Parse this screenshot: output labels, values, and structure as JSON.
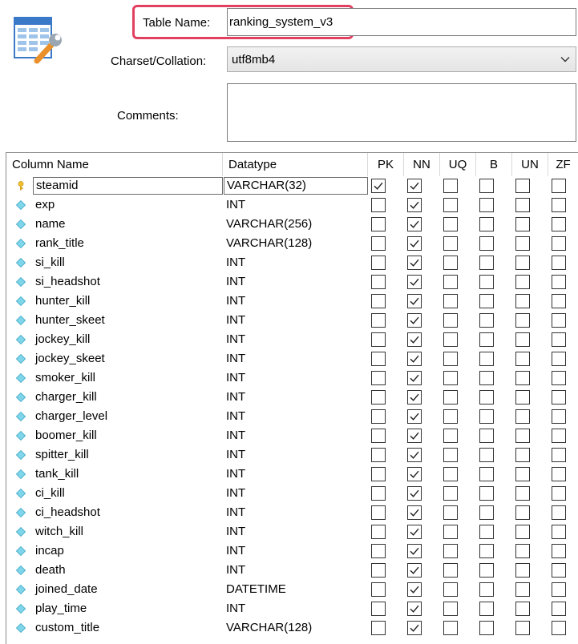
{
  "header": {
    "table_name_label": "Table Name:",
    "table_name_value": "ranking_system_v3",
    "charset_label": "Charset/Collation:",
    "charset_value": "utf8mb4",
    "comments_label": "Comments:",
    "comments_value": "",
    "highlight_color": "#e24060"
  },
  "grid": {
    "columns": [
      "Column Name",
      "Datatype",
      "PK",
      "NN",
      "UQ",
      "B",
      "UN",
      "ZF"
    ],
    "flag_keys": [
      "pk",
      "nn",
      "uq",
      "b",
      "un",
      "zf"
    ],
    "rows": [
      {
        "name": "steamid",
        "type": "VARCHAR(32)",
        "icon": "key-icon",
        "selected": true,
        "pk": true,
        "nn": true,
        "uq": false,
        "b": false,
        "un": false,
        "zf": false
      },
      {
        "name": "exp",
        "type": "INT",
        "icon": "column-diamond-icon",
        "pk": false,
        "nn": true,
        "uq": false,
        "b": false,
        "un": false,
        "zf": false
      },
      {
        "name": "name",
        "type": "VARCHAR(256)",
        "icon": "column-diamond-icon",
        "pk": false,
        "nn": true,
        "uq": false,
        "b": false,
        "un": false,
        "zf": false
      },
      {
        "name": "rank_title",
        "type": "VARCHAR(128)",
        "icon": "column-diamond-icon",
        "pk": false,
        "nn": true,
        "uq": false,
        "b": false,
        "un": false,
        "zf": false
      },
      {
        "name": "si_kill",
        "type": "INT",
        "icon": "column-diamond-icon",
        "pk": false,
        "nn": true,
        "uq": false,
        "b": false,
        "un": false,
        "zf": false
      },
      {
        "name": "si_headshot",
        "type": "INT",
        "icon": "column-diamond-icon",
        "pk": false,
        "nn": true,
        "uq": false,
        "b": false,
        "un": false,
        "zf": false
      },
      {
        "name": "hunter_kill",
        "type": "INT",
        "icon": "column-diamond-icon",
        "pk": false,
        "nn": true,
        "uq": false,
        "b": false,
        "un": false,
        "zf": false
      },
      {
        "name": "hunter_skeet",
        "type": "INT",
        "icon": "column-diamond-icon",
        "pk": false,
        "nn": true,
        "uq": false,
        "b": false,
        "un": false,
        "zf": false
      },
      {
        "name": "jockey_kill",
        "type": "INT",
        "icon": "column-diamond-icon",
        "pk": false,
        "nn": true,
        "uq": false,
        "b": false,
        "un": false,
        "zf": false
      },
      {
        "name": "jockey_skeet",
        "type": "INT",
        "icon": "column-diamond-icon",
        "pk": false,
        "nn": true,
        "uq": false,
        "b": false,
        "un": false,
        "zf": false
      },
      {
        "name": "smoker_kill",
        "type": "INT",
        "icon": "column-diamond-icon",
        "pk": false,
        "nn": true,
        "uq": false,
        "b": false,
        "un": false,
        "zf": false
      },
      {
        "name": "charger_kill",
        "type": "INT",
        "icon": "column-diamond-icon",
        "pk": false,
        "nn": true,
        "uq": false,
        "b": false,
        "un": false,
        "zf": false
      },
      {
        "name": "charger_level",
        "type": "INT",
        "icon": "column-diamond-icon",
        "pk": false,
        "nn": true,
        "uq": false,
        "b": false,
        "un": false,
        "zf": false
      },
      {
        "name": "boomer_kill",
        "type": "INT",
        "icon": "column-diamond-icon",
        "pk": false,
        "nn": true,
        "uq": false,
        "b": false,
        "un": false,
        "zf": false
      },
      {
        "name": "spitter_kill",
        "type": "INT",
        "icon": "column-diamond-icon",
        "pk": false,
        "nn": true,
        "uq": false,
        "b": false,
        "un": false,
        "zf": false
      },
      {
        "name": "tank_kill",
        "type": "INT",
        "icon": "column-diamond-icon",
        "pk": false,
        "nn": true,
        "uq": false,
        "b": false,
        "un": false,
        "zf": false
      },
      {
        "name": "ci_kill",
        "type": "INT",
        "icon": "column-diamond-icon",
        "pk": false,
        "nn": true,
        "uq": false,
        "b": false,
        "un": false,
        "zf": false
      },
      {
        "name": "ci_headshot",
        "type": "INT",
        "icon": "column-diamond-icon",
        "pk": false,
        "nn": true,
        "uq": false,
        "b": false,
        "un": false,
        "zf": false
      },
      {
        "name": "witch_kill",
        "type": "INT",
        "icon": "column-diamond-icon",
        "pk": false,
        "nn": true,
        "uq": false,
        "b": false,
        "un": false,
        "zf": false
      },
      {
        "name": "incap",
        "type": "INT",
        "icon": "column-diamond-icon",
        "pk": false,
        "nn": true,
        "uq": false,
        "b": false,
        "un": false,
        "zf": false
      },
      {
        "name": "death",
        "type": "INT",
        "icon": "column-diamond-icon",
        "pk": false,
        "nn": true,
        "uq": false,
        "b": false,
        "un": false,
        "zf": false
      },
      {
        "name": "joined_date",
        "type": "DATETIME",
        "icon": "column-diamond-icon",
        "pk": false,
        "nn": true,
        "uq": false,
        "b": false,
        "un": false,
        "zf": false
      },
      {
        "name": "play_time",
        "type": "INT",
        "icon": "column-diamond-icon",
        "pk": false,
        "nn": true,
        "uq": false,
        "b": false,
        "un": false,
        "zf": false
      },
      {
        "name": "custom_title",
        "type": "VARCHAR(128)",
        "icon": "column-diamond-icon",
        "pk": false,
        "nn": true,
        "uq": false,
        "b": false,
        "un": false,
        "zf": false
      }
    ]
  }
}
